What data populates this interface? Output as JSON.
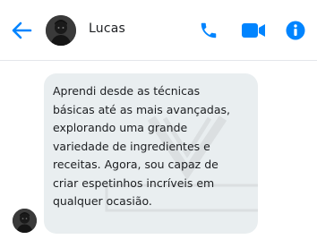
{
  "header": {
    "contact_name": "Lucas",
    "back_icon": "arrow-left-icon",
    "call_icon": "phone-icon",
    "video_icon": "video-camera-icon",
    "info_icon": "info-circle-icon"
  },
  "message": {
    "text": "Aprendi desde as técnicas\nbásicas até as mais avançadas,\nexplorando uma grande\nvariedade de ingredientes e\nreceitas. Agora, sou capaz de\ncriar espetinhos incríveis em\nqualquer ocasião."
  },
  "colors": {
    "accent": "#0084ff",
    "bubble": "#e9eef0",
    "text": "#1c1e21"
  }
}
